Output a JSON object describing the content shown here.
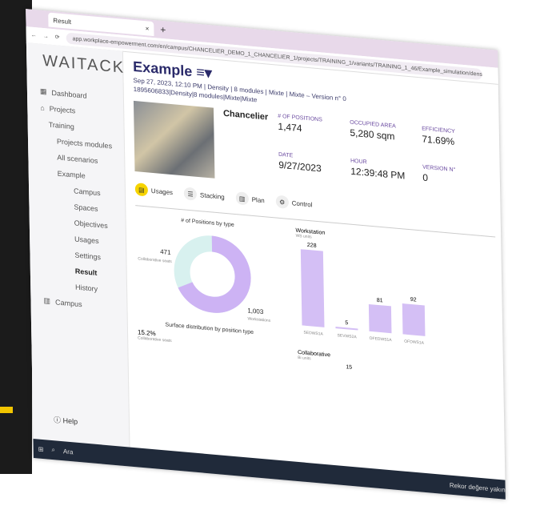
{
  "browser": {
    "tab_title": "Result",
    "url": "app.workplace-empowerment.com/en/campus/CHANCELIER_DEMO_1_CHANCELIER_1/projects/TRAINING_1/variants/TRAINING_1_46/Example_simulation/density/63d9a9e..."
  },
  "sidebar": {
    "logo": "WAITACK",
    "items": [
      "Dashboard",
      "Projects",
      "Training",
      "Projects modules",
      "All scenarios",
      "Example",
      "Campus",
      "Spaces",
      "Objectives",
      "Usages",
      "Settings",
      "Result",
      "History",
      "Campus"
    ],
    "help": "Help"
  },
  "header": {
    "title": "Example",
    "meta1": "Sep 27, 2023, 12:10 PM | Density | 8 modules | Mixte | Mixte – Version n° 0",
    "meta2": "1895606833|Density|8 modules|Mixte|Mixte"
  },
  "card": {
    "name": "Chancelier",
    "stats": [
      {
        "label": "# OF POSITIONS",
        "value": "1,474"
      },
      {
        "label": "OCCUPIED AREA",
        "value": "5,280 sqm"
      },
      {
        "label": "EFFICIENCY",
        "value": "71.69%"
      },
      {
        "label": "DATE",
        "value": "9/27/2023"
      },
      {
        "label": "HOUR",
        "value": "12:39:48 PM"
      },
      {
        "label": "VERSION N°",
        "value": "0"
      }
    ]
  },
  "tabs": [
    "Usages",
    "Stacking",
    "Plan",
    "Control"
  ],
  "charts": {
    "donut_title": "# of Positions by type",
    "donut_labels": [
      "471",
      "Collaborative seats",
      "1,003",
      "Workstations"
    ],
    "surface_title": "Surface distribution by position type",
    "surface_label": "15.2%",
    "surface_sub": "Collaborative seats",
    "bars_title": "Workstation",
    "bars_sub": "WS units",
    "bar_values": [
      228,
      5,
      81,
      92
    ],
    "bar_labels": [
      "SEDWS1A",
      "SEVWS2A",
      "OFEDWS1A",
      "OFDWS1A"
    ],
    "collab_title": "Collaborative",
    "collab_sub": "Bi units",
    "collab_value": "15"
  },
  "taskbar": {
    "search": "Ara",
    "status": "Rekor değere yakın"
  }
}
